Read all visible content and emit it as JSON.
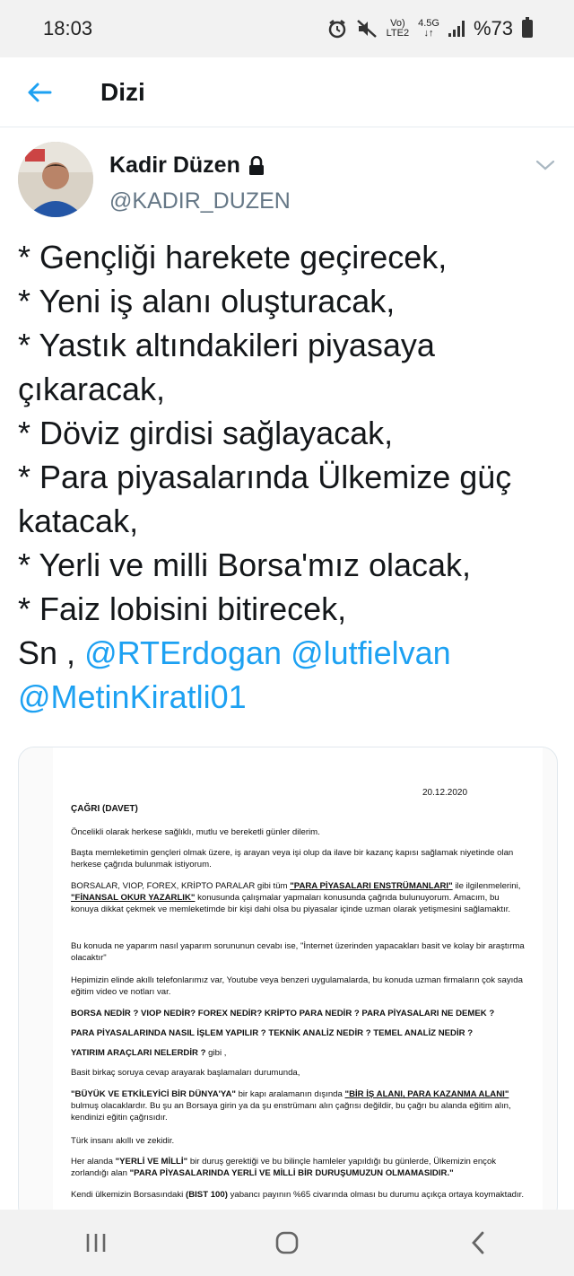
{
  "status_bar": {
    "time": "18:03",
    "network_top": "Vo)",
    "network_bottom": "LTE2",
    "network_gen": "4.5G",
    "battery": "%73"
  },
  "header": {
    "title": "Dizi",
    "back_icon": "arrow-left-icon"
  },
  "author": {
    "name": "Kadir Düzen",
    "handle": "@KADIR_DUZEN",
    "protected_icon": "lock-icon"
  },
  "tweet": {
    "lines": [
      "* Gençliği harekete geçirecek,",
      "* Yeni iş alanı oluşturacak,",
      "* Yastık altındakileri piyasaya",
      "çıkaracak,",
      "* Döviz girdisi sağlayacak,",
      "* Para piyasalarında Ülkemize güç",
      "katacak,",
      "* Yerli ve milli Borsa'mız olacak,",
      "* Faiz lobisini bitirecek,"
    ],
    "prefix": "Sn ,",
    "mentions": [
      "@RTErdogan",
      "@lutfielvan",
      "@MetinKiratli01"
    ]
  },
  "document": {
    "date": "20.12.2020",
    "title": "ÇAĞRI  (DAVET)",
    "p1": "Öncelikli olarak herkese sağlıklı, mutlu ve bereketli günler dilerim.",
    "p2": "Başta memleketimin gençleri olmak üzere, iş arayan veya işi olup da ilave bir kazanç kapısı sağlamak niyetinde olan herkese çağrıda bulunmak istiyorum.",
    "p3a": "BORSALAR, VIOP, FOREX, KRİPTO PARALAR gibi tüm",
    "p3b": "\"PARA PİYASALARI ENSTRÜMANLARI\"",
    "p3c": "ile ilgilenmelerini,",
    "p3d": "\"FİNANSAL OKUR YAZARLIK\"",
    "p3e": "konusunda çalışmalar yapmaları konusunda çağrıda bulunuyorum. Amacım, bu konuya dikkat çekmek ve memleketimde bir kişi dahi olsa bu piyasalar içinde uzman olarak yetişmesini sağlamaktır.",
    "p4": "Bu konuda ne yaparım nasıl yaparım sorununun cevabı ise, \"İnternet üzerinden yapacakları basit ve kolay bir araştırma olacaktır\"",
    "p5": "Hepimizin elinde akıllı telefonlarımız var, Youtube veya benzeri uygulamalarda, bu konuda uzman firmaların çok sayıda eğitim video ve notları var.",
    "q1": "BORSA NEDİR ?   VIOP NEDİR?   FOREX NEDİR?   KRİPTO PARA NEDİR ?   PARA PİYASALARI NE DEMEK ?",
    "q2": "PARA PİYASALARINDA NASIL İŞLEM YAPILIR ?  TEKNİK ANALİZ NEDİR ?   TEMEL ANALİZ NEDİR ?",
    "q3a": "YATIRIM ARAÇLARI NELERDİR ?",
    "q3b": "gibi ,",
    "p6": "Basit birkaç soruya cevap arayarak başlamaları durumunda,",
    "p7a": "\"BÜYÜK VE ETKİLEYİCİ BİR DÜNYA'YA\"",
    "p7b": "bir kapı aralamanın dışında",
    "p7c": "\"BİR İŞ ALANI, PARA KAZANMA ALANI\"",
    "p7d": "bulmuş olacaklardır. Bu şu an Borsaya girin ya da şu enstrümanı alın çağrısı değildir, bu çağrı bu alanda eğitim alın, kendinizi eğitin çağrısıdır.",
    "p8": "Türk insanı akıllı ve zekidir.",
    "p9a": "Her alanda",
    "p9b": "\"YERLİ VE MİLLİ\"",
    "p9c": "bir duruş gerektiği ve bu bilinçle hamleler yapıldığı bu günlerde, Ülkemizin ençok zorlandığı alan",
    "p9d": "\"PARA PİYASALARINDA YERLİ VE MİLLİ BİR DURUŞUMUZUN OLMAMASIDIR.\"",
    "p10a": "Kendi ülkemizin Borsasındaki",
    "p10b": "(BIST 100)",
    "p10c": "yabancı payının %65 civarında olması bu durumu açıkça ortaya koymaktadır."
  },
  "nav": {
    "recents_icon": "recents-icon",
    "home_icon": "home-icon",
    "back_icon": "back-chevron-icon"
  }
}
